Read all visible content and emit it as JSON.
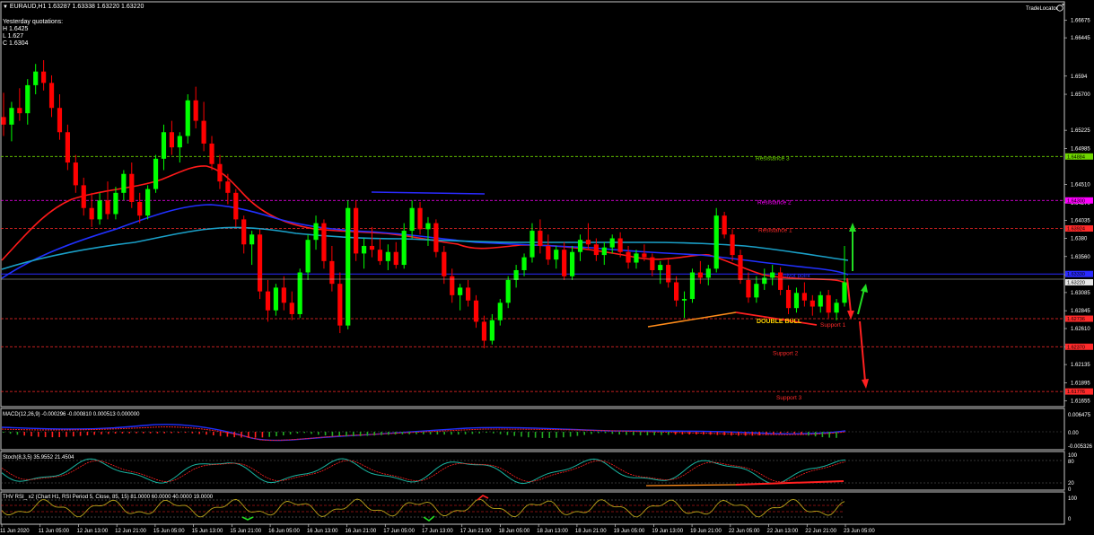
{
  "header": {
    "symbol_line": "EURAUD,H1  1.63287 1.63338 1.63220 1.63220",
    "yesterday_title": "Yesterday quotations:",
    "high": "H 1.6425",
    "low": "L 1.627",
    "close": "C 1.6304",
    "trade_locator": "TradeLocator"
  },
  "colors": {
    "bull": "#00ff00",
    "bear": "#ff0000",
    "ma_red": "#ff1a1a",
    "ma_blue": "#2030ff",
    "ma_cyan": "#1aa0c8",
    "resistance3": "#6fd600",
    "resistance2": "#ff00ff",
    "resistance1": "#ff2a2a",
    "pivot": "#2a2aff",
    "support": "#ff2a2a"
  },
  "chart_data": [
    {
      "type": "candlestick",
      "title": "EURAUD,H1",
      "price_ticks": [
        1.66675,
        1.66445,
        1.6594,
        1.657,
        1.65225,
        1.64985,
        1.6451,
        1.6427,
        1.64035,
        1.638,
        1.6356,
        1.6332,
        1.63085,
        1.62845,
        1.6261,
        1.6237,
        1.62135,
        1.61895,
        1.61655
      ],
      "price_tick_labels": [
        "1.66675",
        "1.66445",
        "1.6594",
        "1.65700",
        "1.65225",
        "1.64985",
        "1.64510",
        "1.64270",
        "1.64035",
        "1.6380",
        "1.63560",
        "1.63320",
        "1.63085",
        "1.62845",
        "1.62610",
        "1.62370",
        "1.62135",
        "1.61895",
        "1.61655"
      ],
      "ylim": [
        1.6158,
        1.6692
      ],
      "x_labels": [
        "11 Jun 2020",
        "11 Jun 05:00",
        "12 Jun 13:00",
        "12 Jun 21:00",
        "15 Jun 05:00",
        "15 Jun 13:00",
        "15 Jun 21:00",
        "16 Jun 05:00",
        "16 Jun 13:00",
        "16 Jun 21:00",
        "17 Jun 05:00",
        "17 Jun 13:00",
        "17 Jun 21:00",
        "18 Jun 05:00",
        "18 Jun 13:00",
        "18 Jun 21:00",
        "19 Jun 05:00",
        "19 Jun 13:00",
        "19 Jun 21:00",
        "22 Jun 05:00",
        "22 Jun 13:00",
        "22 Jun 21:00",
        "23 Jun 05:00"
      ],
      "current_price": 1.6322,
      "current_price_label": "1.63220",
      "levels": [
        {
          "name": "Resistance 3",
          "value": 1.6488,
          "label": "1.64884",
          "color": "#6fd600"
        },
        {
          "name": "Resistance 2",
          "value": 1.643,
          "label": "1.64300",
          "color": "#ff00ff"
        },
        {
          "name": "Resistance 1",
          "value": 1.6393,
          "label": "1.63924",
          "color": "#ff2a2a"
        },
        {
          "name": "pivot point",
          "value": 1.6333,
          "label": "1.63330",
          "color": "#2a2aff"
        },
        {
          "name": "Support 1",
          "value": 1.6274,
          "label": "1.62736",
          "color": "#ff2a2a"
        },
        {
          "name": "Support 2",
          "value": 1.6237,
          "label": "1.62370",
          "color": "#ff2a2a"
        },
        {
          "name": "Support 3",
          "value": 1.6178,
          "label": "1.61776",
          "color": "#ff2a2a"
        }
      ],
      "annotations": {
        "pattern": "DOUBLE BULL"
      },
      "candles": [
        [
          1.654,
          1.6572,
          1.6515,
          1.653
        ],
        [
          1.653,
          1.656,
          1.6508,
          1.6552
        ],
        [
          1.6552,
          1.6578,
          1.6535,
          1.6545
        ],
        [
          1.6545,
          1.659,
          1.653,
          1.6582
        ],
        [
          1.6582,
          1.661,
          1.657,
          1.66
        ],
        [
          1.66,
          1.6615,
          1.6575,
          1.6585
        ],
        [
          1.6585,
          1.6595,
          1.654,
          1.6552
        ],
        [
          1.6552,
          1.657,
          1.651,
          1.652
        ],
        [
          1.652,
          1.653,
          1.647,
          1.648
        ],
        [
          1.648,
          1.649,
          1.644,
          1.645
        ],
        [
          1.645,
          1.646,
          1.641,
          1.642
        ],
        [
          1.642,
          1.644,
          1.6395,
          1.6405
        ],
        [
          1.6405,
          1.644,
          1.6398,
          1.643
        ],
        [
          1.643,
          1.6455,
          1.6405,
          1.6412
        ],
        [
          1.6412,
          1.6448,
          1.6405,
          1.644
        ],
        [
          1.644,
          1.647,
          1.643,
          1.6465
        ],
        [
          1.6465,
          1.648,
          1.642,
          1.6428
        ],
        [
          1.6428,
          1.644,
          1.64,
          1.641
        ],
        [
          1.641,
          1.645,
          1.6405,
          1.6445
        ],
        [
          1.6445,
          1.649,
          1.644,
          1.6485
        ],
        [
          1.6485,
          1.653,
          1.647,
          1.652
        ],
        [
          1.652,
          1.6535,
          1.649,
          1.65
        ],
        [
          1.65,
          1.652,
          1.648,
          1.6515
        ],
        [
          1.6515,
          1.657,
          1.6505,
          1.6562
        ],
        [
          1.6562,
          1.658,
          1.6525,
          1.6535
        ],
        [
          1.6535,
          1.656,
          1.6495,
          1.6505
        ],
        [
          1.6505,
          1.6515,
          1.647,
          1.6478
        ],
        [
          1.6478,
          1.649,
          1.6445,
          1.6455
        ],
        [
          1.6455,
          1.6465,
          1.6425,
          1.644
        ],
        [
          1.644,
          1.6445,
          1.6395,
          1.6405
        ],
        [
          1.6405,
          1.641,
          1.636,
          1.6372
        ],
        [
          1.6372,
          1.639,
          1.6345,
          1.6385
        ],
        [
          1.6385,
          1.6392,
          1.63,
          1.631
        ],
        [
          1.631,
          1.6325,
          1.627,
          1.6285
        ],
        [
          1.6285,
          1.632,
          1.6278,
          1.6315
        ],
        [
          1.6315,
          1.633,
          1.6285,
          1.6295
        ],
        [
          1.6295,
          1.631,
          1.6272,
          1.628
        ],
        [
          1.628,
          1.634,
          1.6275,
          1.6335
        ],
        [
          1.6335,
          1.6385,
          1.6325,
          1.6378
        ],
        [
          1.6378,
          1.641,
          1.6365,
          1.64
        ],
        [
          1.64,
          1.6405,
          1.634,
          1.635
        ],
        [
          1.635,
          1.637,
          1.631,
          1.632
        ],
        [
          1.632,
          1.6335,
          1.6255,
          1.6265
        ],
        [
          1.6265,
          1.643,
          1.626,
          1.642
        ],
        [
          1.642,
          1.643,
          1.635,
          1.636
        ],
        [
          1.636,
          1.638,
          1.634,
          1.637
        ],
        [
          1.637,
          1.6395,
          1.6355,
          1.6365
        ],
        [
          1.6365,
          1.638,
          1.6345,
          1.635
        ],
        [
          1.635,
          1.6372,
          1.6338,
          1.6362
        ],
        [
          1.6362,
          1.6375,
          1.634,
          1.6345
        ],
        [
          1.6345,
          1.64,
          1.634,
          1.639
        ],
        [
          1.639,
          1.643,
          1.638,
          1.642
        ],
        [
          1.642,
          1.6428,
          1.6385,
          1.6392
        ],
        [
          1.6392,
          1.6408,
          1.637,
          1.64
        ],
        [
          1.64,
          1.6405,
          1.6355,
          1.6362
        ],
        [
          1.6362,
          1.637,
          1.632,
          1.633
        ],
        [
          1.633,
          1.634,
          1.6295,
          1.6305
        ],
        [
          1.6305,
          1.632,
          1.6285,
          1.6315
        ],
        [
          1.6315,
          1.6325,
          1.629,
          1.6298
        ],
        [
          1.6298,
          1.6305,
          1.6262,
          1.627
        ],
        [
          1.627,
          1.6278,
          1.6235,
          1.6245
        ],
        [
          1.6245,
          1.628,
          1.624,
          1.6272
        ],
        [
          1.6272,
          1.63,
          1.6265,
          1.6295
        ],
        [
          1.6295,
          1.633,
          1.6288,
          1.6325
        ],
        [
          1.6325,
          1.6345,
          1.6315,
          1.6338
        ],
        [
          1.6338,
          1.636,
          1.633,
          1.6355
        ],
        [
          1.6355,
          1.64,
          1.6348,
          1.639
        ],
        [
          1.639,
          1.6405,
          1.636,
          1.637
        ],
        [
          1.637,
          1.6385,
          1.6345,
          1.6352
        ],
        [
          1.6352,
          1.637,
          1.634,
          1.6365
        ],
        [
          1.6365,
          1.6375,
          1.6325,
          1.633
        ],
        [
          1.633,
          1.637,
          1.6325,
          1.6362
        ],
        [
          1.6362,
          1.6385,
          1.635,
          1.6378
        ],
        [
          1.6378,
          1.64,
          1.6365,
          1.6372
        ],
        [
          1.6372,
          1.638,
          1.635,
          1.6358
        ],
        [
          1.6358,
          1.6375,
          1.6345,
          1.6368
        ],
        [
          1.6368,
          1.6385,
          1.636,
          1.638
        ],
        [
          1.638,
          1.6388,
          1.6355,
          1.6362
        ],
        [
          1.6362,
          1.637,
          1.634,
          1.6348
        ],
        [
          1.6348,
          1.6365,
          1.634,
          1.636
        ],
        [
          1.636,
          1.6372,
          1.635,
          1.6355
        ],
        [
          1.6355,
          1.636,
          1.633,
          1.6338
        ],
        [
          1.6338,
          1.635,
          1.632,
          1.6345
        ],
        [
          1.6345,
          1.6352,
          1.6315,
          1.6322
        ],
        [
          1.6322,
          1.633,
          1.629,
          1.6298
        ],
        [
          1.6298,
          1.631,
          1.6275,
          1.63
        ],
        [
          1.63,
          1.634,
          1.6295,
          1.6335
        ],
        [
          1.6335,
          1.635,
          1.632,
          1.6328
        ],
        [
          1.6328,
          1.6345,
          1.6318,
          1.634
        ],
        [
          1.634,
          1.642,
          1.6335,
          1.641
        ],
        [
          1.641,
          1.6415,
          1.638,
          1.6385
        ],
        [
          1.6385,
          1.6392,
          1.635,
          1.6358
        ],
        [
          1.6358,
          1.6365,
          1.632,
          1.6325
        ],
        [
          1.6325,
          1.6335,
          1.6295,
          1.6302
        ],
        [
          1.6302,
          1.633,
          1.6295,
          1.632
        ],
        [
          1.632,
          1.634,
          1.6312,
          1.6328
        ],
        [
          1.6328,
          1.6345,
          1.6318,
          1.6335
        ],
        [
          1.6335,
          1.6342,
          1.6305,
          1.6312
        ],
        [
          1.6312,
          1.6318,
          1.628,
          1.6288
        ],
        [
          1.6288,
          1.6315,
          1.6282,
          1.6308
        ],
        [
          1.6308,
          1.6322,
          1.629,
          1.6298
        ],
        [
          1.6298,
          1.6305,
          1.6278,
          1.629
        ],
        [
          1.629,
          1.631,
          1.6282,
          1.6305
        ],
        [
          1.6305,
          1.6312,
          1.6275,
          1.6282
        ],
        [
          1.6282,
          1.63,
          1.6272,
          1.6295
        ],
        [
          1.6295,
          1.637,
          1.629,
          1.6322
        ]
      ]
    },
    {
      "type": "line",
      "title": "MACD(12,26,9) -0.000296 -0.000810 0.000513 0.000000",
      "y_tick_labels": [
        "0.006475",
        "0.00",
        "-0.005326"
      ]
    },
    {
      "type": "line",
      "title": "Stoch(8,3,5) 35.9552 21.4504",
      "y_tick_labels": [
        "100",
        "80",
        "20",
        "0"
      ]
    },
    {
      "type": "line",
      "title": "THV RSI_ x2 (Chart H1, RSI Period 5, Close, 85, 15) 81.0000 60.0000 40.0000 19.0000",
      "y_tick_labels": [
        "100",
        "0"
      ]
    }
  ]
}
